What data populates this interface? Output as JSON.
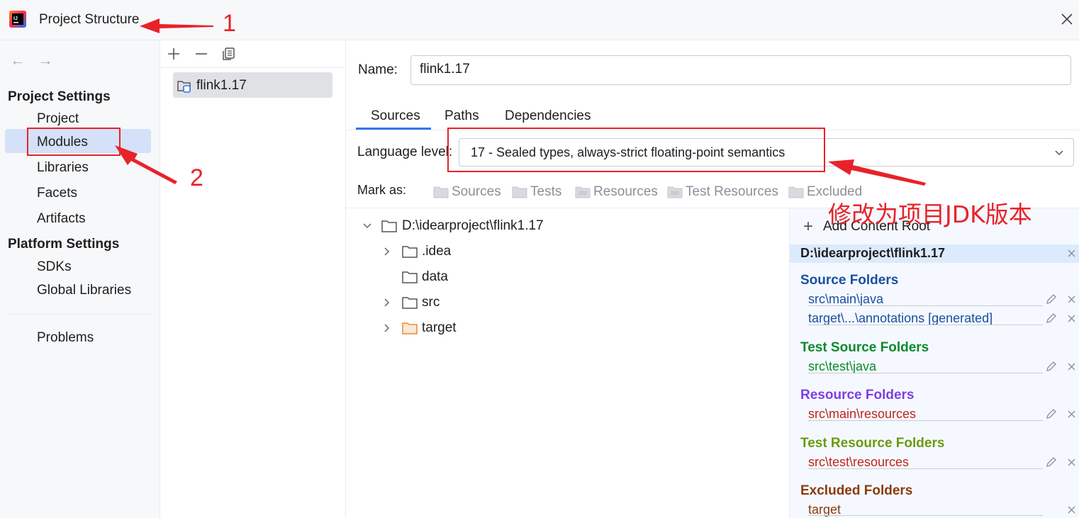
{
  "window": {
    "title": "Project Structure",
    "icon": "intellij-icon",
    "close_icon": "close-icon"
  },
  "sidebar": {
    "back_icon": "arrow-left-icon",
    "forward_icon": "arrow-right-icon",
    "project_settings_title": "Project Settings",
    "project_settings_items": [
      "Project",
      "Modules",
      "Libraries",
      "Facets",
      "Artifacts"
    ],
    "platform_settings_title": "Platform Settings",
    "platform_settings_items": [
      "SDKs",
      "Global Libraries"
    ],
    "problems": "Problems",
    "selected_item": "Modules"
  },
  "module_list": {
    "toolbar": [
      "add-icon",
      "remove-icon",
      "copy-icon"
    ],
    "modules": [
      "flink1.17"
    ],
    "selected": "flink1.17"
  },
  "module": {
    "name_label": "Name:",
    "name_value": "flink1.17",
    "tabs": [
      "Sources",
      "Paths",
      "Dependencies"
    ],
    "active_tab": "Sources",
    "language_level_label": "Language level:",
    "language_level_value": "17 - Sealed types, always-strict floating-point semantics",
    "mark_as_label": "Mark as:",
    "mark_as_options": [
      "Sources",
      "Tests",
      "Resources",
      "Test Resources",
      "Excluded"
    ]
  },
  "tree": {
    "root": "D:\\idearproject\\flink1.17",
    "children": [
      ".idea",
      "data",
      "src",
      "target"
    ]
  },
  "content_roots": {
    "add_label": "Add Content Root",
    "root_path": "D:\\idearproject\\flink1.17",
    "source_folders_title": "Source Folders",
    "source_folders": [
      "src\\main\\java",
      "target\\...\\annotations [generated]"
    ],
    "test_source_folders_title": "Test Source Folders",
    "test_source_folders": [
      "src\\test\\java"
    ],
    "resource_folders_title": "Resource Folders",
    "resource_folders": [
      "src\\main\\resources"
    ],
    "test_resource_folders_title": "Test Resource Folders",
    "test_resource_folders": [
      "src\\test\\resources"
    ],
    "excluded_folders_title": "Excluded Folders",
    "excluded_folders": [
      "target"
    ]
  },
  "annotations": {
    "step1": "1",
    "step2": "2",
    "note": "修改为项目JDK版本"
  },
  "colors": {
    "accent": "#3574f0",
    "source": "#1a4fa0",
    "test_source": "#0b8a2d",
    "resource": "#7e3ee6",
    "test_resource": "#6a9a0e",
    "excluded": "#8a3a0c",
    "annotation_red": "#e8222a"
  }
}
